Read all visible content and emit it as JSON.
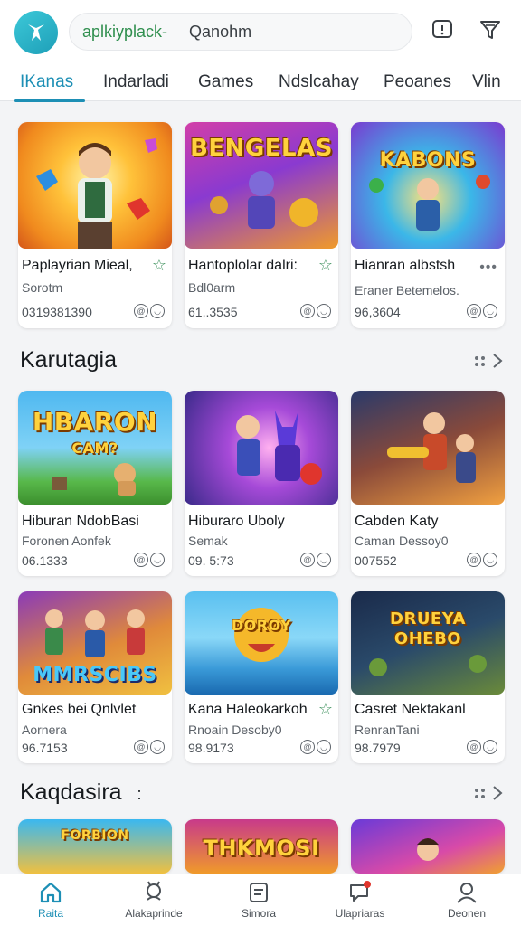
{
  "header": {
    "search": {
      "brand": "aplkiyplack-",
      "query": "Qanohm"
    },
    "icons": {
      "logo": "app-logo-icon",
      "notifications": "notification-bell-icon",
      "filter": "filter-icon"
    }
  },
  "tabs": [
    "IKanas",
    "Indarladi",
    "Games",
    "Ndslcahay",
    "Peoanes",
    "Vlin"
  ],
  "row1": [
    {
      "title": "Paplayrian Mieal,",
      "sub": "Sorotm",
      "meta": "0319381390",
      "thumb_text": "",
      "action": "star"
    },
    {
      "title": "Hantoplolar dalri:",
      "sub": "Bdl0arm",
      "meta": "61,.3535",
      "thumb_text": "BENGELAS",
      "action": "star"
    },
    {
      "title": "Hianran albstsh",
      "sub": "Eraner Betemelos.",
      "meta": "96,3604",
      "thumb_text": "KABONS",
      "action": "more"
    }
  ],
  "section1": {
    "title": "Karutagia"
  },
  "row2": [
    {
      "title": "Hiburan NdobBasi",
      "sub": "Foronen Aonfek",
      "meta": "06.1333",
      "thumb_text": "HBARON",
      "thumb_text2": "CAM?"
    },
    {
      "title": "Hiburaro Uboly",
      "sub": "Semak",
      "meta": "09. 5:73",
      "thumb_text": ""
    },
    {
      "title": "Cabden Katy",
      "sub": "Caman Dessoy0",
      "meta": "007552",
      "thumb_text": ""
    }
  ],
  "row3": [
    {
      "title": "Gnkes bei Qnlvlet",
      "sub": "Aornera",
      "meta": "96.7153",
      "thumb_text": "MMRSCIBS",
      "action": "none"
    },
    {
      "title": "Kana Haleokarkoh",
      "sub": "Rnoain Desoby0",
      "meta": "98.9173",
      "thumb_text": "DOROY",
      "action": "star"
    },
    {
      "title": "Casret Nektakanl",
      "sub": "RenranTani",
      "meta": "98.7979",
      "thumb_text": "DRUEYA OHEBO",
      "action": "none"
    }
  ],
  "section2": {
    "title": "Kaqdasira",
    "suffix": ":"
  },
  "row4": [
    {
      "thumb_text": "FORBION"
    },
    {
      "thumb_text": "THKMOSI"
    },
    {
      "thumb_text": ""
    }
  ],
  "bottom_nav": [
    {
      "label": "Raita",
      "icon": "home-icon"
    },
    {
      "label": "Alakaprinde",
      "icon": "gamepad-icon"
    },
    {
      "label": "Simora",
      "icon": "list-icon"
    },
    {
      "label": "Ulapriaras",
      "icon": "chat-icon"
    },
    {
      "label": "Deonen",
      "icon": "profile-icon"
    }
  ],
  "colors": {
    "accent": "#1d8fb5",
    "brand": "#2f8f4e",
    "star": "#3a8f5a"
  }
}
